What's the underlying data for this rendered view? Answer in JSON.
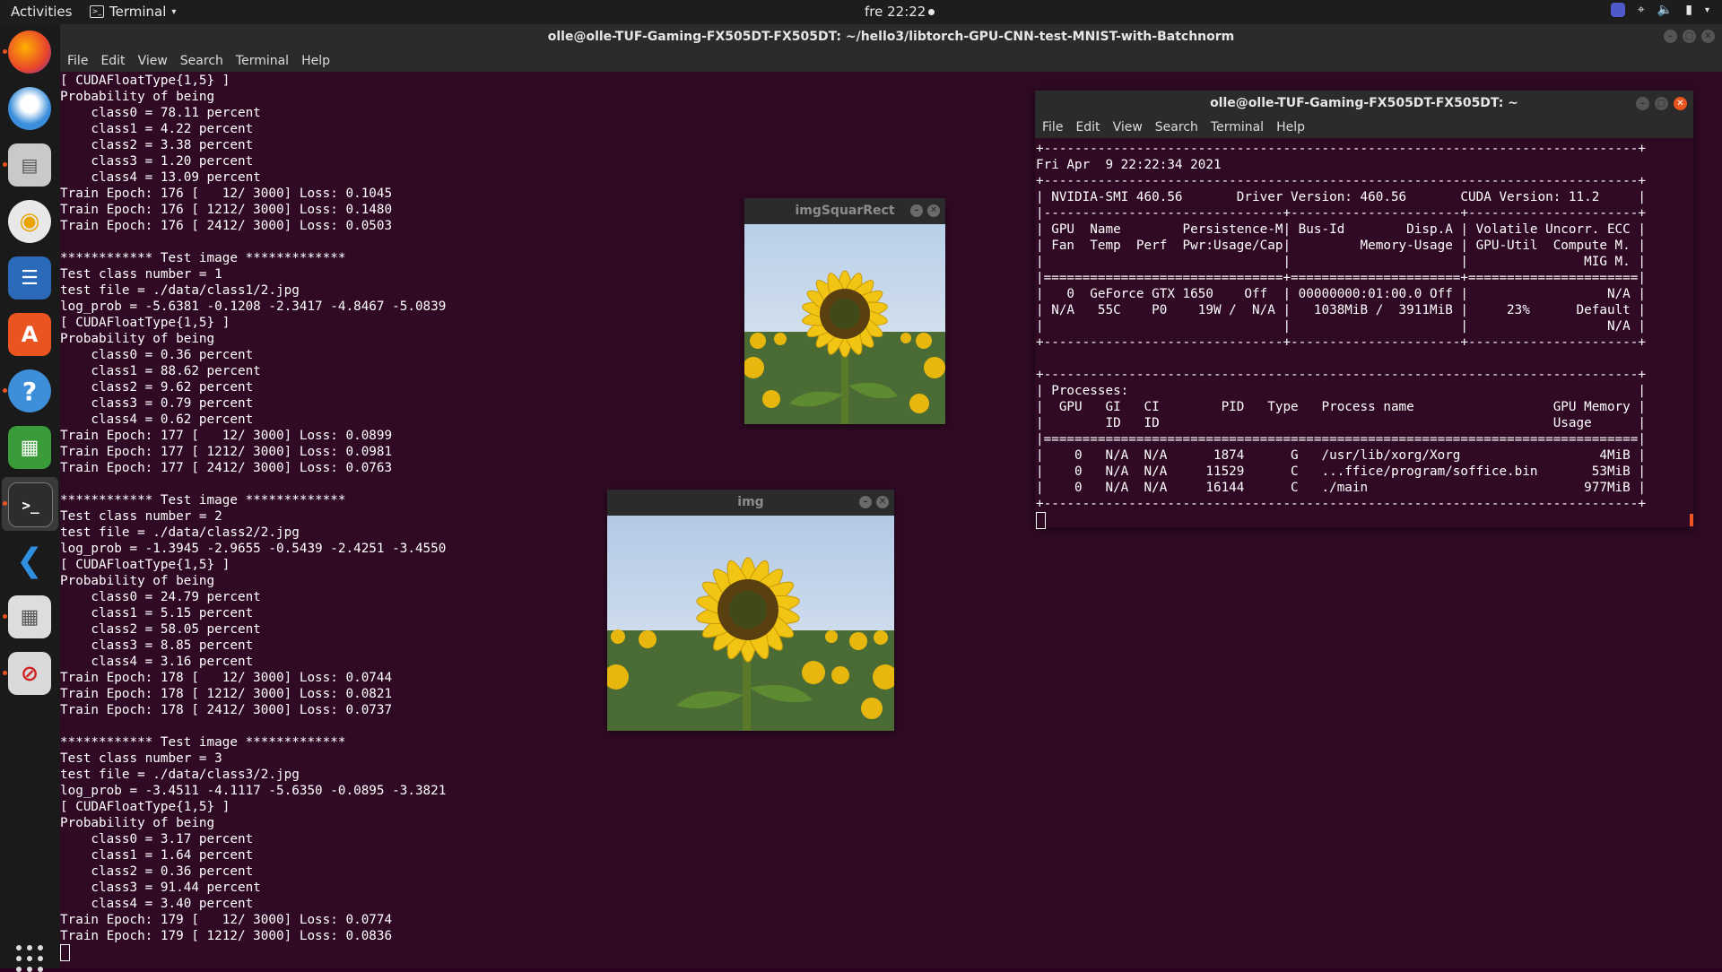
{
  "topbar": {
    "activities": "Activities",
    "app_name": "Terminal",
    "clock": "fre 22:22",
    "tray_icons": [
      "teams-icon",
      "network-icon",
      "volume-icon",
      "battery-icon",
      "system-menu-icon"
    ]
  },
  "dock": {
    "items": [
      "firefox-icon",
      "thunderbird-icon",
      "files-icon",
      "rhythmbox-icon",
      "libreoffice-writer-icon",
      "software-center-icon",
      "help-icon",
      "libreoffice-calc-icon",
      "terminal-icon",
      "vscode-icon",
      "calculator-icon",
      "unknown-app-icon",
      "show-apps-icon"
    ]
  },
  "main_terminal": {
    "title": "olle@olle-TUF-Gaming-FX505DT-FX505DT: ~/hello3/libtorch-GPU-CNN-test-MNIST-with-Batchnorm",
    "menu": [
      "File",
      "Edit",
      "View",
      "Search",
      "Terminal",
      "Help"
    ],
    "lines": [
      "[ CUDAFloatType{1,5} ]",
      "Probability of being",
      "    class0 = 78.11 percent",
      "    class1 = 4.22 percent",
      "    class2 = 3.38 percent",
      "    class3 = 1.20 percent",
      "    class4 = 13.09 percent",
      "Train Epoch: 176 [   12/ 3000] Loss: 0.1045",
      "Train Epoch: 176 [ 1212/ 3000] Loss: 0.1480",
      "Train Epoch: 176 [ 2412/ 3000] Loss: 0.0503",
      "",
      "************ Test image *************",
      "Test class number = 1",
      "test file = ./data/class1/2.jpg",
      "log_prob = -5.6381 -0.1208 -2.3417 -4.8467 -5.0839",
      "[ CUDAFloatType{1,5} ]",
      "Probability of being",
      "    class0 = 0.36 percent",
      "    class1 = 88.62 percent",
      "    class2 = 9.62 percent",
      "    class3 = 0.79 percent",
      "    class4 = 0.62 percent",
      "Train Epoch: 177 [   12/ 3000] Loss: 0.0899",
      "Train Epoch: 177 [ 1212/ 3000] Loss: 0.0981",
      "Train Epoch: 177 [ 2412/ 3000] Loss: 0.0763",
      "",
      "************ Test image *************",
      "Test class number = 2",
      "test file = ./data/class2/2.jpg",
      "log_prob = -1.3945 -2.9655 -0.5439 -2.4251 -3.4550",
      "[ CUDAFloatType{1,5} ]",
      "Probability of being",
      "    class0 = 24.79 percent",
      "    class1 = 5.15 percent",
      "    class2 = 58.05 percent",
      "    class3 = 8.85 percent",
      "    class4 = 3.16 percent",
      "Train Epoch: 178 [   12/ 3000] Loss: 0.0744",
      "Train Epoch: 178 [ 1212/ 3000] Loss: 0.0821",
      "Train Epoch: 178 [ 2412/ 3000] Loss: 0.0737",
      "",
      "************ Test image *************",
      "Test class number = 3",
      "test file = ./data/class3/2.jpg",
      "log_prob = -3.4511 -4.1117 -5.6350 -0.0895 -3.3821",
      "[ CUDAFloatType{1,5} ]",
      "Probability of being",
      "    class0 = 3.17 percent",
      "    class1 = 1.64 percent",
      "    class2 = 0.36 percent",
      "    class3 = 91.44 percent",
      "    class4 = 3.40 percent",
      "Train Epoch: 179 [   12/ 3000] Loss: 0.0774",
      "Train Epoch: 179 [ 1212/ 3000] Loss: 0.0836"
    ]
  },
  "img_square_window": {
    "title": "imgSquarRect"
  },
  "img_window": {
    "title": "img"
  },
  "smi_terminal": {
    "title": "olle@olle-TUF-Gaming-FX505DT-FX505DT: ~",
    "menu": [
      "File",
      "Edit",
      "View",
      "Search",
      "Terminal",
      "Help"
    ],
    "lines": [
      "+-----------------------------------------------------------------------------+",
      "Fri Apr  9 22:22:34 2021",
      "+-----------------------------------------------------------------------------+",
      "| NVIDIA-SMI 460.56       Driver Version: 460.56       CUDA Version: 11.2     |",
      "|-------------------------------+----------------------+----------------------+",
      "| GPU  Name        Persistence-M| Bus-Id        Disp.A | Volatile Uncorr. ECC |",
      "| Fan  Temp  Perf  Pwr:Usage/Cap|         Memory-Usage | GPU-Util  Compute M. |",
      "|                               |                      |               MIG M. |",
      "|===============================+======================+======================|",
      "|   0  GeForce GTX 1650    Off  | 00000000:01:00.0 Off |                  N/A |",
      "| N/A   55C    P0    19W /  N/A |   1038MiB /  3911MiB |     23%      Default |",
      "|                               |                      |                  N/A |",
      "+-------------------------------+----------------------+----------------------+",
      "",
      "+-----------------------------------------------------------------------------+",
      "| Processes:                                                                  |",
      "|  GPU   GI   CI        PID   Type   Process name                  GPU Memory |",
      "|        ID   ID                                                   Usage      |",
      "|=============================================================================|",
      "|    0   N/A  N/A      1874      G   /usr/lib/xorg/Xorg                  4MiB |",
      "|    0   N/A  N/A     11529      C   ...ffice/program/soffice.bin       53MiB |",
      "|    0   N/A  N/A     16144      C   ./main                            977MiB |",
      "+-----------------------------------------------------------------------------+"
    ]
  },
  "colors": {
    "terminal_bg": "#300a24",
    "accent": "#e95420"
  }
}
